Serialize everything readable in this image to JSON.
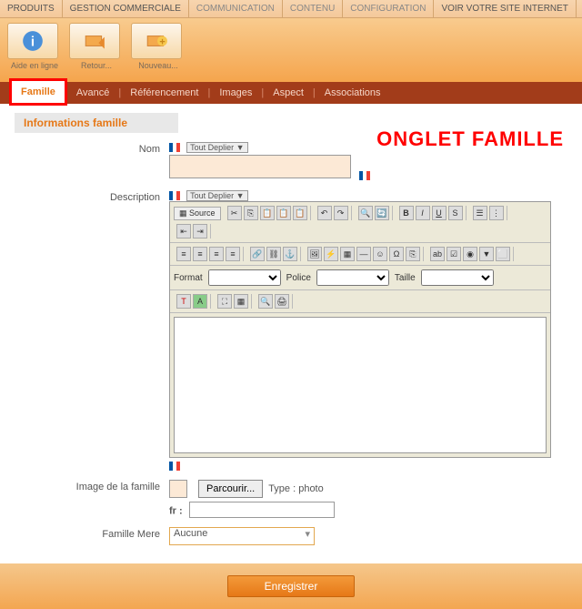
{
  "topnav": {
    "items": [
      "PRODUITS",
      "GESTION COMMERCIALE",
      "COMMUNICATION",
      "CONTENU",
      "CONFIGURATION",
      "VOIR VOTRE SITE INTERNET"
    ]
  },
  "ribbon": {
    "help": "Aide en ligne",
    "back": "Retour...",
    "new": "Nouveau..."
  },
  "tabs": {
    "items": [
      "Famille",
      "Avancé",
      "Référencement",
      "Images",
      "Aspect",
      "Associations"
    ]
  },
  "overlay": "ONGLET FAMILLE",
  "section": "Informations famille",
  "labels": {
    "nom": "Nom",
    "desc": "Description",
    "image": "Image de la famille",
    "mere": "Famille Mere",
    "tout": "Tout Deplier ▼",
    "source": "Source",
    "format": "Format",
    "police": "Police",
    "taille": "Taille",
    "parcourir": "Parcourir...",
    "type": "Type : photo",
    "fr": "fr :",
    "aucune": "Aucune",
    "save": "Enregistrer"
  }
}
